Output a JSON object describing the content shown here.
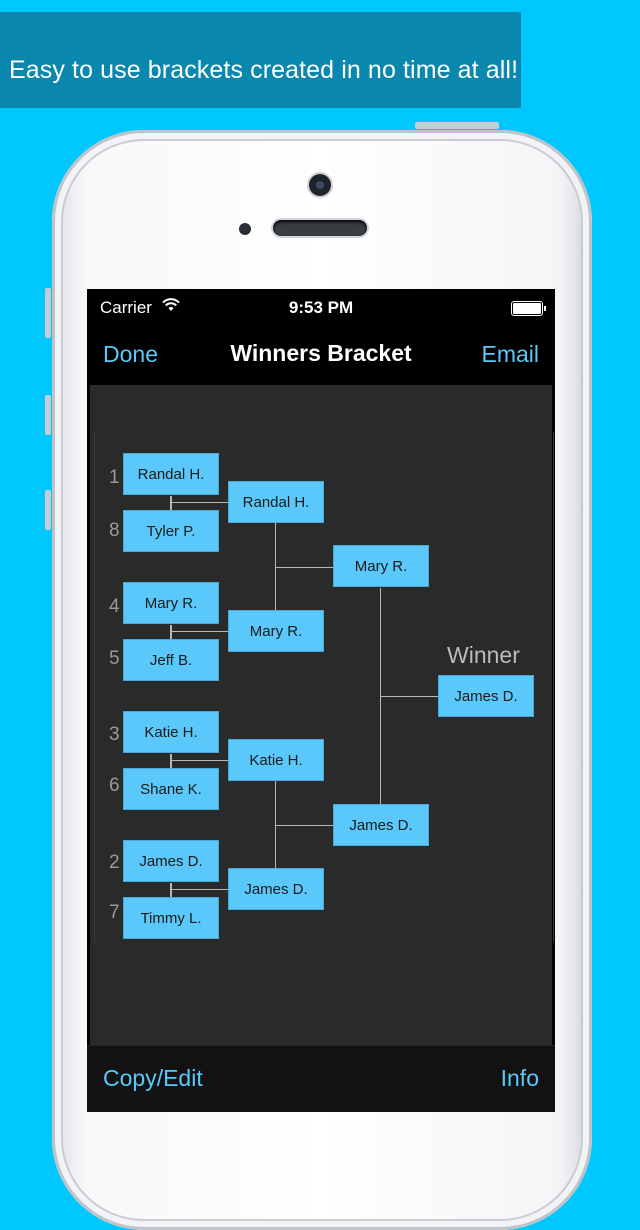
{
  "banner": {
    "text": "Easy to use brackets created in no time at all!"
  },
  "status_bar": {
    "carrier": "Carrier",
    "time": "9:53 PM",
    "wifi_icon": "wifi-icon",
    "battery_icon": "battery-icon"
  },
  "nav": {
    "left": "Done",
    "title": "Winners Bracket",
    "right": "Email"
  },
  "bracket": {
    "round1": [
      {
        "seed": "1",
        "name": "Randal H."
      },
      {
        "seed": "8",
        "name": "Tyler P."
      },
      {
        "seed": "4",
        "name": "Mary R."
      },
      {
        "seed": "5",
        "name": "Jeff B."
      },
      {
        "seed": "3",
        "name": "Katie H."
      },
      {
        "seed": "6",
        "name": "Shane K."
      },
      {
        "seed": "2",
        "name": "James D."
      },
      {
        "seed": "7",
        "name": "Timmy L."
      }
    ],
    "round2": [
      "Randal H.",
      "Mary R.",
      "Katie H.",
      "James D."
    ],
    "round3": [
      "Mary R.",
      "James D."
    ],
    "winner_label": "Winner",
    "winner": "James D."
  },
  "toolbar": {
    "left": "Copy/Edit",
    "right": "Info"
  },
  "colors": {
    "background": "#00c8ff",
    "banner": "#0a87ae",
    "accent": "#5ac8fa",
    "screen": "#2a2a2a"
  }
}
